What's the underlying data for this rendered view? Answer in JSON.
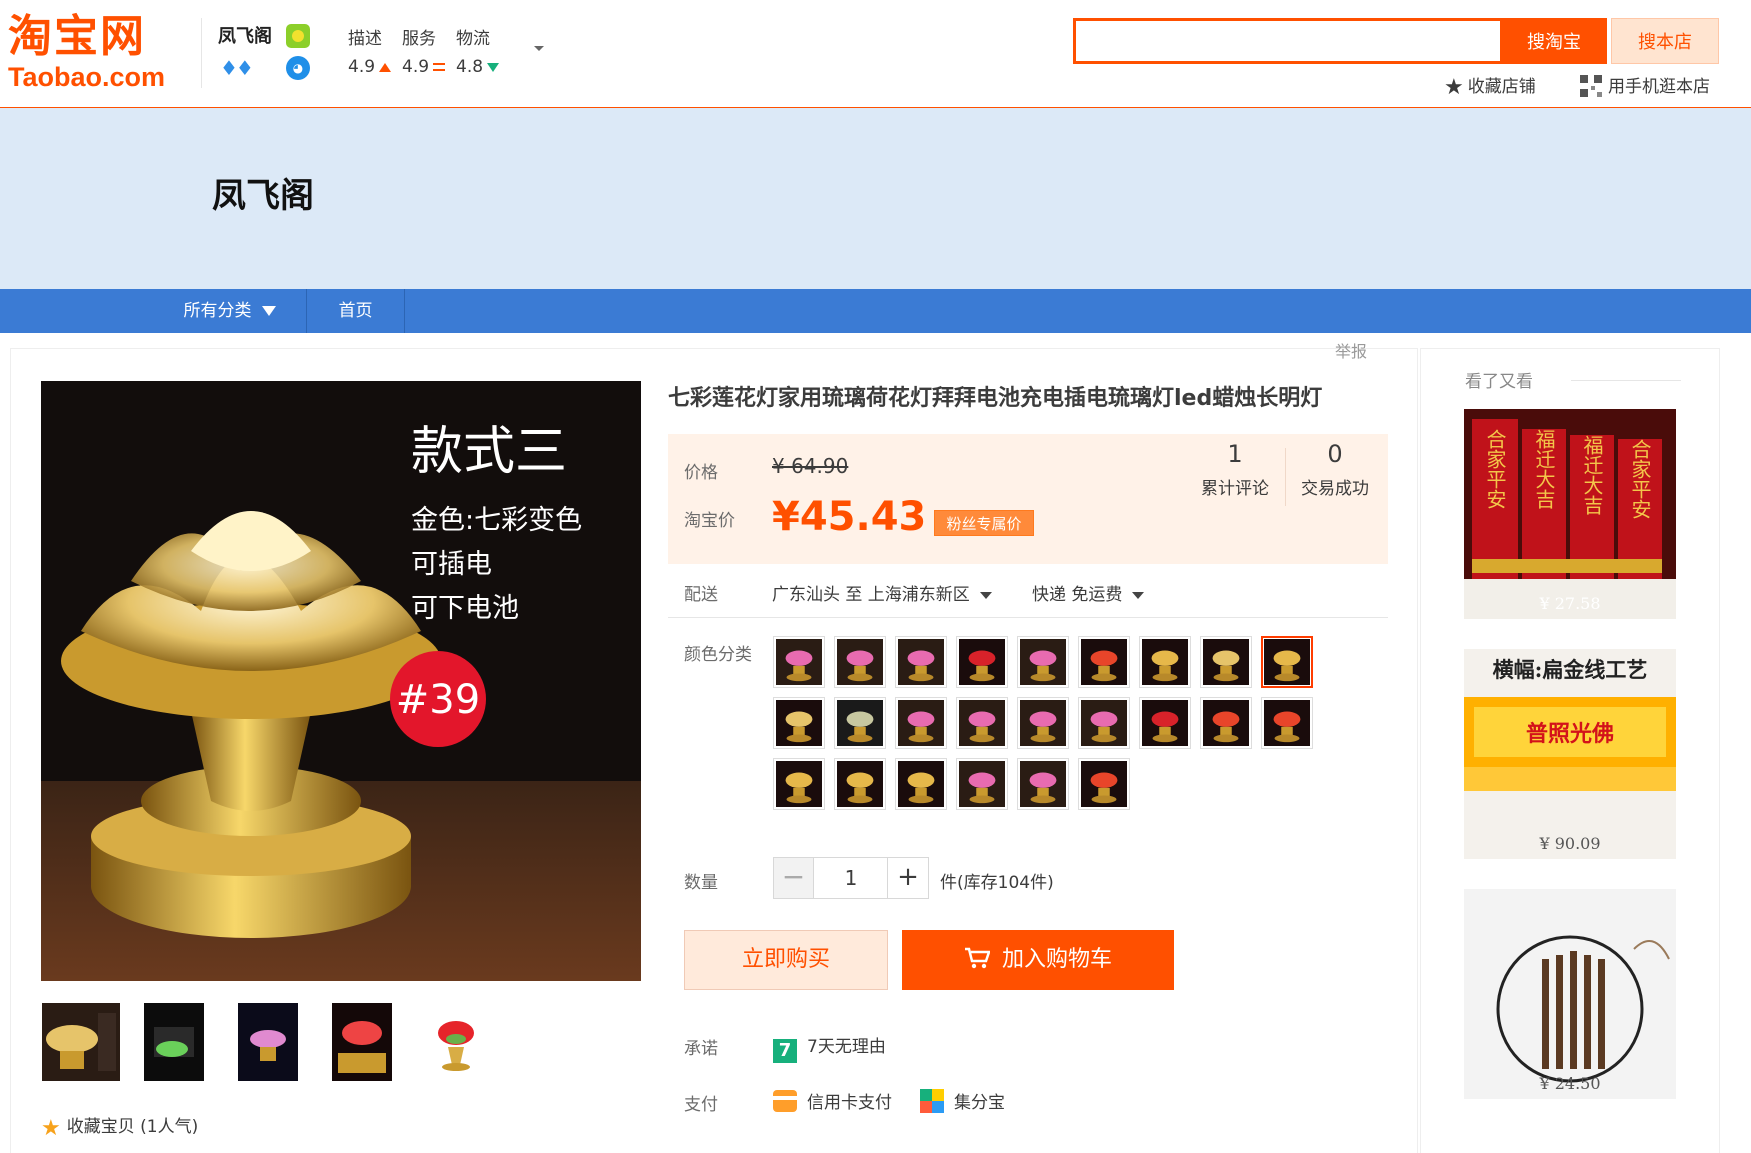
{
  "header": {
    "logo_cn": "淘宝网",
    "logo_en": "Taobao.com",
    "shop_name": "凤飞阁",
    "ratings": [
      {
        "label": "描述",
        "value": "4.9",
        "trend": "up"
      },
      {
        "label": "服务",
        "value": "4.9",
        "trend": "equal"
      },
      {
        "label": "物流",
        "value": "4.8",
        "trend": "down"
      }
    ],
    "search": {
      "placeholder": "",
      "value": "",
      "btn_taobao": "搜淘宝",
      "btn_shop": "搜本店"
    },
    "links": {
      "favorite_shop": "收藏店铺",
      "mobile_shop": "用手机逛本店"
    }
  },
  "banner": {
    "shop_title": "凤飞阁"
  },
  "nav": {
    "all_categories": "所有分类",
    "home": "首页"
  },
  "main": {
    "report": "举报",
    "image_text": {
      "line1": "款式三",
      "line2": "金色:七彩变色",
      "line3": "可插电",
      "line4": "可下电池",
      "badge": "#39"
    },
    "favorite_item": "收藏宝贝 (1人气)"
  },
  "product": {
    "title": "七彩莲花灯家用琉璃荷花灯拜拜电池充电插电琉璃灯led蜡烛长明灯",
    "price_label": "价格",
    "original_price": "¥ 64.90",
    "taobao_price_label": "淘宝价",
    "current_price": "¥45.43",
    "fans_price": "粉丝专属价",
    "stats": [
      {
        "num": "1",
        "caption": "累计评论"
      },
      {
        "num": "0",
        "caption": "交易成功"
      }
    ],
    "shipping": {
      "label": "配送",
      "route": "广东汕头 至  上海浦东新区",
      "method": "快递 免运费"
    },
    "color_label": "颜色分类",
    "quantity": {
      "label": "数量",
      "value": "1",
      "stock": "件(库存104件)"
    },
    "buy_now": "立即购买",
    "add_to_cart": "加入购物车",
    "promise": {
      "label": "承诺",
      "icon_text": "7",
      "text": "7天无理由"
    },
    "payment": {
      "label": "支付",
      "method1": "信用卡支付",
      "method2": "集分宝"
    }
  },
  "sidebar": {
    "heading": "看了又看",
    "recs": [
      {
        "price": "¥ 27.58",
        "texts": [
          "合家平安",
          "福迁大吉",
          "福迁大吉",
          "合家平安"
        ]
      },
      {
        "price": "¥ 90.09",
        "texts": [
          "横幅:扁金线工艺",
          "普照光佛"
        ]
      },
      {
        "price": "¥ 24.50",
        "texts": []
      }
    ]
  }
}
